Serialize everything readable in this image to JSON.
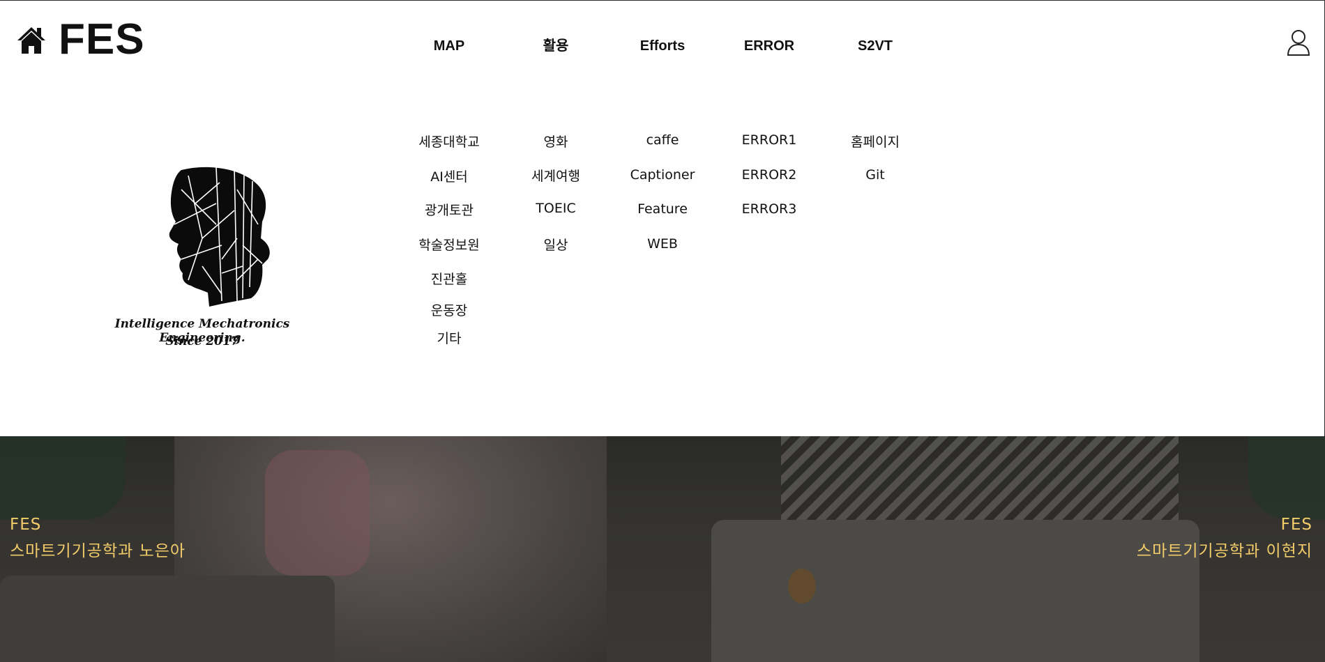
{
  "brand": "FES",
  "nav": [
    {
      "label": "MAP",
      "items": [
        "세종대학교",
        "AI센터",
        "광개토관",
        "학술정보원",
        "진관홀",
        "운동장",
        "기타"
      ]
    },
    {
      "label": "활용",
      "items": [
        "영화",
        "세계여행",
        "TOEIC",
        "일상"
      ]
    },
    {
      "label": "Efforts",
      "items": [
        "caffe",
        "Captioner",
        "Feature",
        "WEB"
      ]
    },
    {
      "label": "ERROR",
      "items": [
        "ERROR1",
        "ERROR2",
        "ERROR3"
      ]
    },
    {
      "label": "S2VT",
      "items": [
        "홈페이지",
        "Git"
      ]
    }
  ],
  "logo": {
    "line1": "Intelligence Mechatronics Engineering.",
    "line2": "Since 2017"
  },
  "hero": {
    "left_line1": "FES",
    "left_line2": "스마트기기공학과 노은아",
    "right_line1": "FES",
    "right_line2": "스마트기기공학과 이현지"
  },
  "icons": {
    "home": "home-icon",
    "user": "user-icon"
  },
  "colors": {
    "hero_text": "#f3cc6a",
    "hero_bg": "#34332f"
  }
}
